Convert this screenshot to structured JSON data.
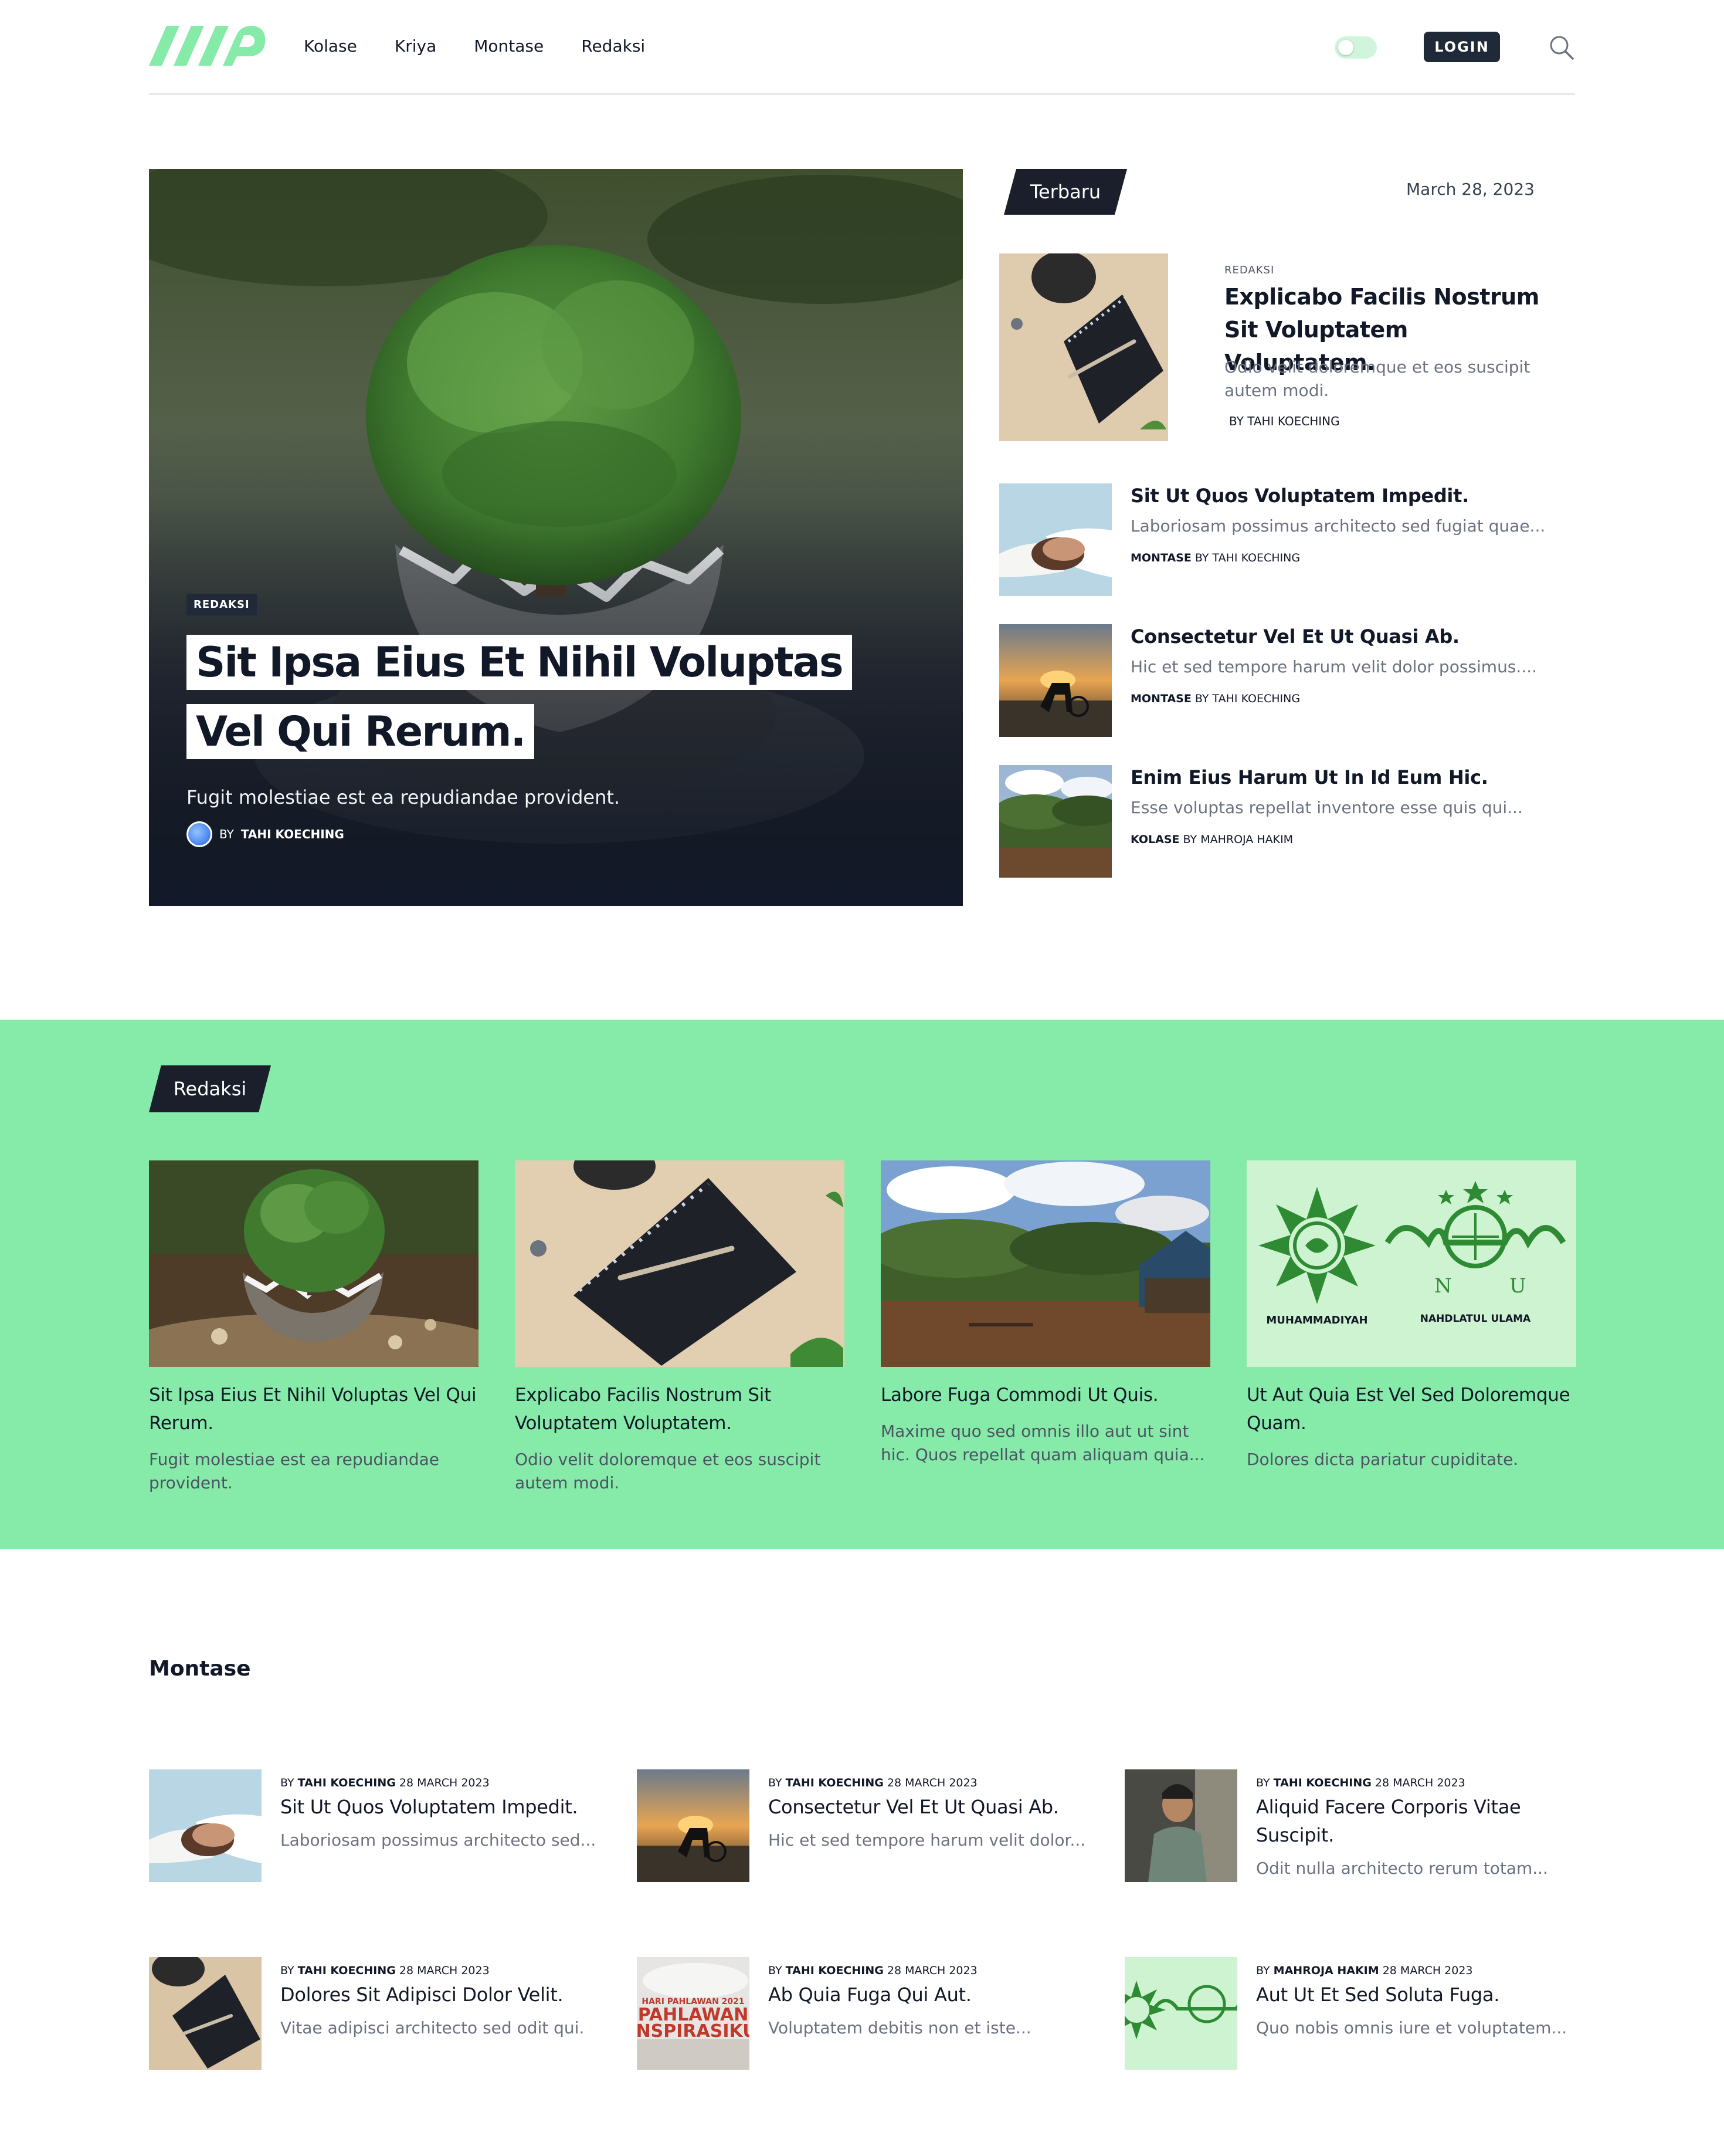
{
  "nav": {
    "items": [
      "Kolase",
      "Kriya",
      "Montase",
      "Redaksi"
    ],
    "login_label": "LOGIN"
  },
  "hero": {
    "category": "REDAKSI",
    "title": "Sit Ipsa Eius Et Nihil Voluptas Vel Qui Rerum.",
    "excerpt": "Fugit molestiae est ea repudiandae provident.",
    "by": "BY",
    "author": "TAHI KOECHING"
  },
  "sidebar": {
    "label": "Terbaru",
    "date": "March 28, 2023",
    "featured": {
      "category": "REDAKSI",
      "title": "Explicabo Facilis Nostrum Sit Voluptatem Voluptatem.",
      "excerpt": "Odio velit doloremque et eos suscipit autem modi.",
      "byline": "BY TAHI KOECHING"
    },
    "items": [
      {
        "title": "Sit Ut Quos Voluptatem Impedit.",
        "excerpt": "Laboriosam possimus architecto sed fugiat quae...",
        "category": "MONTASE",
        "byline": "BY TAHI KOECHING"
      },
      {
        "title": "Consectetur Vel Et Ut Quasi Ab.",
        "excerpt": "Hic et sed tempore harum velit dolor possimus....",
        "category": "MONTASE",
        "byline": "BY TAHI KOECHING"
      },
      {
        "title": "Enim Eius Harum Ut In Id Eum Hic.",
        "excerpt": "Esse voluptas repellat inventore esse quis qui...",
        "category": "KOLASE",
        "byline": "BY MAHROJA HAKIM"
      }
    ]
  },
  "redaksi": {
    "label": "Redaksi",
    "cards": [
      {
        "title": "Sit Ipsa Eius Et Nihil Voluptas Vel Qui Rerum.",
        "excerpt": "Fugit molestiae est ea repudiandae provident."
      },
      {
        "title": "Explicabo Facilis Nostrum Sit Voluptatem Voluptatem.",
        "excerpt": "Odio velit doloremque et eos suscipit autem modi."
      },
      {
        "title": "Labore Fuga Commodi Ut Quis.",
        "excerpt": "Maxime quo sed omnis illo aut ut sint hic. Quos repellat quam aliquam quia..."
      },
      {
        "title": "Ut Aut Quia Est Vel Sed Doloremque Quam.",
        "excerpt": "Dolores dicta pariatur cupiditate."
      }
    ],
    "logo_captions": [
      "MUHAMMADIYAH",
      "NAHDLATUL ULAMA"
    ]
  },
  "montase": {
    "heading": "Montase",
    "by": "BY",
    "items": [
      {
        "author": "TAHI KOECHING",
        "date": "28 MARCH 2023",
        "title": "Sit Ut Quos Voluptatem Impedit.",
        "excerpt": "Laboriosam possimus architecto sed..."
      },
      {
        "author": "TAHI KOECHING",
        "date": "28 MARCH 2023",
        "title": "Consectetur Vel Et Ut Quasi Ab.",
        "excerpt": "Hic et sed tempore harum velit dolor..."
      },
      {
        "author": "TAHI KOECHING",
        "date": "28 MARCH 2023",
        "title": "Aliquid Facere Corporis Vitae Suscipit.",
        "excerpt": "Odit nulla architecto rerum totam..."
      },
      {
        "author": "TAHI KOECHING",
        "date": "28 MARCH 2023",
        "title": "Dolores Sit Adipisci Dolor Velit.",
        "excerpt": "Vitae adipisci architecto sed odit qui."
      },
      {
        "author": "TAHI KOECHING",
        "date": "28 MARCH 2023",
        "title": "Ab Quia Fuga Qui Aut.",
        "excerpt": "Voluptatem debitis non et iste..."
      },
      {
        "author": "MAHROJA HAKIM",
        "date": "28 MARCH 2023",
        "title": "Aut Ut Et Sed Soluta Fuga.",
        "excerpt": "Quo nobis omnis iure et voluptatem..."
      }
    ],
    "poster_text": [
      "HARI PAHLAWAN 2021",
      "PAHLAWAN",
      "INSPIRASIKU"
    ]
  },
  "colors": {
    "accent": "#86eaa9",
    "dark": "#1a1f2b",
    "muted": "#6b7280"
  },
  "icons": {
    "search": "search-icon",
    "logo": "site-logo"
  }
}
